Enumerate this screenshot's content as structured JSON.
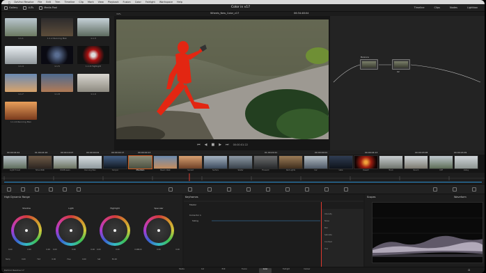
{
  "menubar": {
    "app": "DaVinci Resolve",
    "items": [
      "File",
      "Edit",
      "Trim",
      "Timeline",
      "Clip",
      "Mark",
      "View",
      "Playback",
      "Fusion",
      "Color",
      "Fairlight",
      "Workspace",
      "Help"
    ]
  },
  "toolbar": {
    "gallery": "Gallery",
    "luts": "LUTs",
    "media_pool": "Media Pool",
    "project_title": "Color in v17",
    "right": [
      "Timeline",
      "Clips",
      "Nodes",
      "Lightbox"
    ]
  },
  "viewer": {
    "zoom": "34%",
    "clip_title": "Wheels_New_Color_v17",
    "timecode": "06:34:48:04",
    "playback_timecode": "00:00:01:22"
  },
  "gallery": {
    "stills": [
      {
        "label": "1.1.1"
      },
      {
        "label": "1.1.2 Running Man"
      },
      {
        "label": "1.1.3"
      },
      {
        "label": "1.1.4"
      },
      {
        "label": "1.1.5"
      },
      {
        "label": "1.1.6 Highlight"
      },
      {
        "label": "1.1.7"
      },
      {
        "label": "1.1.8"
      },
      {
        "label": "1.1.9"
      },
      {
        "label": "1.1.10 Running Man"
      }
    ]
  },
  "nodes": {
    "node1_label": "Balance",
    "node2_label": "02"
  },
  "clips": {
    "timecodes": [
      "00:00:04:22",
      "01:00:24:16",
      "00:00:10:07",
      "00:00:00:02",
      "00:00:02:17",
      "00:00:00:13",
      "01:00:20:21",
      "00:00:00:01",
      "00:00:04:13",
      "00:00:03:08",
      "00:00:24:09"
    ],
    "names": [
      "Light Forest",
      "Shoe Walk",
      "Wildflowers",
      "Running Man",
      "Canyon",
      "Mountain",
      "Beach Walk",
      "Sunset",
      "Surfers",
      "Skater",
      "Firework",
      "Red Lights",
      "Car",
      "Lake",
      "Desert",
      "Truck",
      "Ranch",
      "Cliff",
      "Valley"
    ],
    "selected_index": 5
  },
  "palette": {
    "panel": "High Dynamic Range",
    "keyframes": "Keyframes",
    "scopes": "Scopes",
    "scope_type": "Waveform"
  },
  "wheels": {
    "items": [
      {
        "label": "Shadow",
        "vals": [
          "0.00",
          "0.00",
          "0.00"
        ]
      },
      {
        "label": "Light",
        "vals": [
          "0.00",
          "0.00",
          "0.00"
        ]
      },
      {
        "label": "Highlight",
        "vals": [
          "0.00",
          "0.00",
          "0.00"
        ]
      },
      {
        "label": "Specular",
        "vals": [
          "0.00",
          "0.00",
          "0.00"
        ]
      }
    ],
    "bottom": [
      "Temp",
      "0.00",
      "Tint",
      "0.00",
      "Hue",
      "0.00",
      "Sat",
      "50.00"
    ]
  },
  "keyframes_panel": {
    "rows": [
      "Master",
      "Corrector 1",
      "Sizing",
      "Scale",
      "Pan"
    ],
    "side": [
      "Intensity",
      "Noise",
      "Blur",
      "Saturate",
      "Contrast",
      "Hue"
    ]
  },
  "pages": [
    "Media",
    "Cut",
    "Edit",
    "Fusion",
    "Color",
    "Fairlight",
    "Deliver"
  ],
  "active_page": "Color",
  "footer_app": "DaVinci Resolve 17"
}
